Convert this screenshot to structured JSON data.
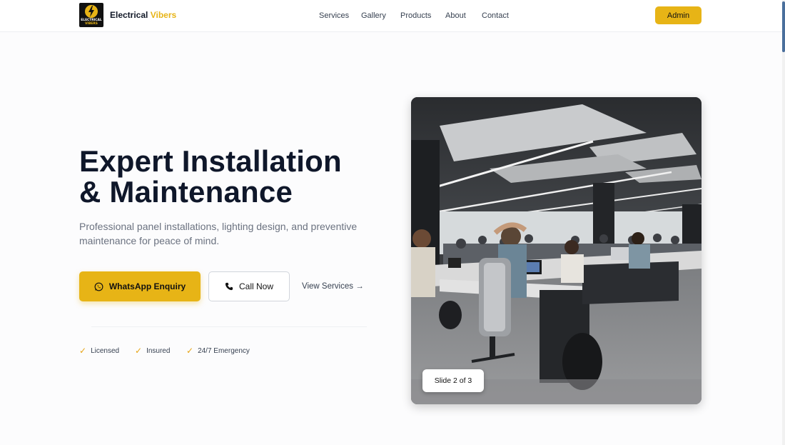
{
  "brand": {
    "logo_line1": "ELECTRICAL",
    "logo_line2": "VIBERS",
    "name": "Electrical",
    "name_accent": "Vibers"
  },
  "nav": {
    "items": [
      {
        "label": "Services"
      },
      {
        "label": "Gallery"
      },
      {
        "label": "Products"
      },
      {
        "label": "About"
      },
      {
        "label": "Contact"
      }
    ],
    "admin_label": "Admin"
  },
  "hero": {
    "title_line1": "Expert Installation",
    "title_line2": "& Maintenance",
    "subtitle": "Professional panel installations, lighting design, and preventive maintenance for peace of mind.",
    "whatsapp_label": "WhatsApp Enquiry",
    "call_label": "Call Now",
    "services_link": "View Services →",
    "badges": [
      {
        "label": "Licensed"
      },
      {
        "label": "Insured"
      },
      {
        "label": "24/7 Emergency"
      }
    ]
  },
  "carousel": {
    "slide_indicator": "Slide 2 of 3"
  },
  "icons": {
    "whatsapp": "whatsapp-icon",
    "phone": "phone-icon",
    "check": "check-icon",
    "bolt": "lightning-bolt-icon"
  },
  "colors": {
    "accent": "#e7b416",
    "text": "#0f172a",
    "muted": "#6b7280"
  }
}
